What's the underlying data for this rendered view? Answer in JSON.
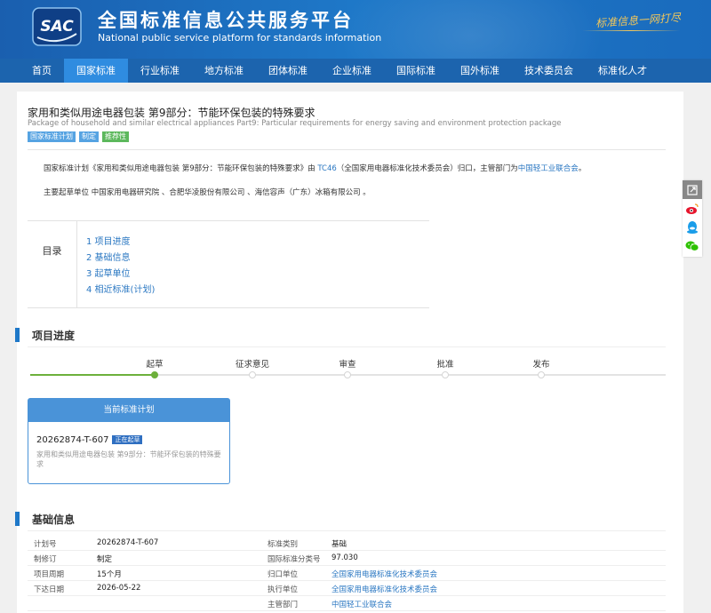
{
  "header": {
    "logo_text": "SAC",
    "title": "全国标准信息公共服务平台",
    "subtitle": "National public service platform  for standards information",
    "slogan": "标准信息一网打尽"
  },
  "nav": [
    {
      "label": "首页",
      "active": false
    },
    {
      "label": "国家标准",
      "active": true
    },
    {
      "label": "行业标准",
      "active": false
    },
    {
      "label": "地方标准",
      "active": false
    },
    {
      "label": "团体标准",
      "active": false
    },
    {
      "label": "企业标准",
      "active": false
    },
    {
      "label": "国际标准",
      "active": false
    },
    {
      "label": "国外标准",
      "active": false
    },
    {
      "label": "技术委员会",
      "active": false
    },
    {
      "label": "标准化人才",
      "active": false
    }
  ],
  "standard": {
    "title": "家用和类似用途电器包装 第9部分：节能环保包装的特殊要求",
    "title_en": "Package of household and similar electrical appliances Part9: Particular requirements for energy saving and environment protection package",
    "tags": [
      "国家标准计划",
      "制定",
      "推荐性"
    ],
    "para1_a": "国家标准计划《家用和类似用途电器包装 第9部分：节能环保包装的特殊要求》由 ",
    "para1_link1": "TC46",
    "para1_b": "（全国家用电器标准化技术委员会）归口，主管部门为",
    "para1_link2": "中国轻工业联合会",
    "para1_c": "。",
    "para2": "主要起草单位 中国家用电器研究院 、合肥华凌股份有限公司 、海信容声（广东）冰箱有限公司 。"
  },
  "toc": {
    "label": "目录",
    "items": [
      "1  项目进度",
      "2  基础信息",
      "3  起草单位",
      "4  相近标准(计划)"
    ]
  },
  "progress": {
    "section_title": "项目进度",
    "steps": [
      "起草",
      "征求意见",
      "审查",
      "批准",
      "发布"
    ],
    "current_step": 1,
    "card_title": "当前标准计划",
    "card_code": "20262874-T-607",
    "card_badge": "正在起草",
    "card_desc": "家用和类似用途电器包装 第9部分：节能环保包装的特殊要求"
  },
  "basic_info": {
    "section_title": "基础信息",
    "rows": [
      {
        "k1": "计划号",
        "v1": "20262874-T-607",
        "k2": "标准类别",
        "v2": "基础"
      },
      {
        "k1": "制修订",
        "v1": "制定",
        "k2": "国际标准分类号",
        "v2": "97.030"
      },
      {
        "k1": "项目周期",
        "v1": "15个月",
        "k2": "归口单位",
        "v2": "全国家用电器标准化技术委员会"
      },
      {
        "k1": "下达日期",
        "v1": "2026-05-22",
        "k2": "执行单位",
        "v2": "全国家用电器标准化技术委员会"
      },
      {
        "k1": "",
        "v1": "",
        "k2": "主管部门",
        "v2": "中国轻工业联合会"
      }
    ]
  },
  "share": [
    "share-icon",
    "weibo-icon",
    "qq-icon",
    "wechat-icon"
  ],
  "colors": {
    "primary": "#1c64ae",
    "accent": "#2f8ce0",
    "done": "#6db03b",
    "link": "#2a77c2"
  }
}
